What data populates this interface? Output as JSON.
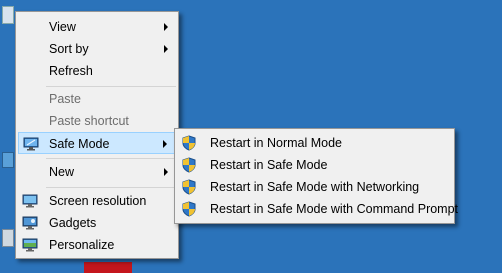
{
  "context_menu": {
    "items": [
      {
        "label": "View",
        "has_submenu": true
      },
      {
        "label": "Sort by",
        "has_submenu": true
      },
      {
        "label": "Refresh"
      },
      {
        "label": "Paste",
        "disabled": true
      },
      {
        "label": "Paste shortcut",
        "disabled": true
      },
      {
        "label": "Safe Mode",
        "has_submenu": true,
        "highlighted": true,
        "icon": "safe-mode-icon"
      },
      {
        "label": "New",
        "has_submenu": true
      },
      {
        "label": "Screen resolution",
        "icon": "screen-resolution-icon"
      },
      {
        "label": "Gadgets",
        "icon": "gadgets-icon"
      },
      {
        "label": "Personalize",
        "icon": "personalize-icon"
      }
    ]
  },
  "submenu": {
    "items": [
      {
        "label": "Restart in Normal Mode",
        "icon": "uac-shield-icon"
      },
      {
        "label": "Restart in Safe Mode",
        "icon": "uac-shield-icon"
      },
      {
        "label": "Restart in Safe Mode with Networking",
        "icon": "uac-shield-icon"
      },
      {
        "label": "Restart in Safe Mode with Command Prompt",
        "icon": "uac-shield-icon"
      }
    ]
  },
  "colors": {
    "desktop": "#2b73ba",
    "menu": "#f0f0f0",
    "highlight": "#cce8ff"
  }
}
